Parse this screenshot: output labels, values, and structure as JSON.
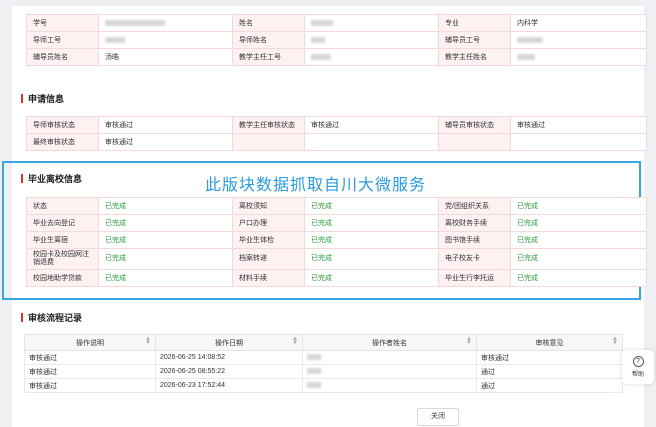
{
  "basic": {
    "rows": [
      [
        {
          "label": "学号",
          "value": "",
          "blur": 60
        },
        {
          "label": "姓名",
          "value": "",
          "blur": 22
        },
        {
          "label": "专业",
          "value": "内科学",
          "blur": 0
        }
      ],
      [
        {
          "label": "导师工号",
          "value": "",
          "blur": 20
        },
        {
          "label": "导师姓名",
          "value": "",
          "blur": 14
        },
        {
          "label": "辅导员工号",
          "value": "",
          "blur": 26
        }
      ],
      [
        {
          "label": "辅导员姓名",
          "value": "汤皓",
          "blur": 0
        },
        {
          "label": "教学主任工号",
          "value": "",
          "blur": 20
        },
        {
          "label": "教学主任姓名",
          "value": "",
          "blur": 18
        }
      ]
    ]
  },
  "apply": {
    "title": "申请信息",
    "rows": [
      [
        {
          "label": "导师审核状态",
          "value": "审核通过"
        },
        {
          "label": "教学主任审核状态",
          "value": "审核通过"
        },
        {
          "label": "辅导员审核状态",
          "value": "审核通过"
        }
      ],
      [
        {
          "label": "最终审核状态",
          "value": "审核通过"
        }
      ]
    ]
  },
  "leave": {
    "title": "毕业离校信息",
    "overlay_text": "此版块数据抓取自川大微服务",
    "rows": [
      [
        {
          "label": "状态",
          "value": "已完成"
        },
        {
          "label": "离校须知",
          "value": "已完成"
        },
        {
          "label": "党/团组织关系",
          "value": "已完成"
        }
      ],
      [
        {
          "label": "毕业去向登记",
          "value": "已完成"
        },
        {
          "label": "户口办理",
          "value": "已完成"
        },
        {
          "label": "离校财务手续",
          "value": "已完成"
        }
      ],
      [
        {
          "label": "毕业生离宿",
          "value": "已完成"
        },
        {
          "label": "毕业生体检",
          "value": "已完成"
        },
        {
          "label": "图书馆手续",
          "value": "已完成"
        }
      ],
      [
        {
          "label": "校园卡及校园网注销退费",
          "value": "已完成"
        },
        {
          "label": "档案转递",
          "value": "已完成"
        },
        {
          "label": "电子校友卡",
          "value": "已完成"
        }
      ],
      [
        {
          "label": "校园地助学贷款",
          "value": "已完成"
        },
        {
          "label": "材料手续",
          "value": "已完成"
        },
        {
          "label": "毕业生行李托运",
          "value": "已完成"
        }
      ]
    ]
  },
  "flow": {
    "title": "审核流程记录",
    "headers": [
      "操作说明",
      "操作日期",
      "操作者姓名",
      "审核意见"
    ],
    "rows": [
      {
        "action": "审核通过",
        "date": "2026-06-25 14:08:52",
        "opinion": "审核通过"
      },
      {
        "action": "审核通过",
        "date": "2026-06-25 08:55:22",
        "opinion": "通过"
      },
      {
        "action": "审核通过",
        "date": "2026-06-23 17:52:44",
        "opinion": "通过"
      }
    ]
  },
  "buttons": {
    "close": "关闭"
  },
  "help": {
    "label": "帮助"
  }
}
